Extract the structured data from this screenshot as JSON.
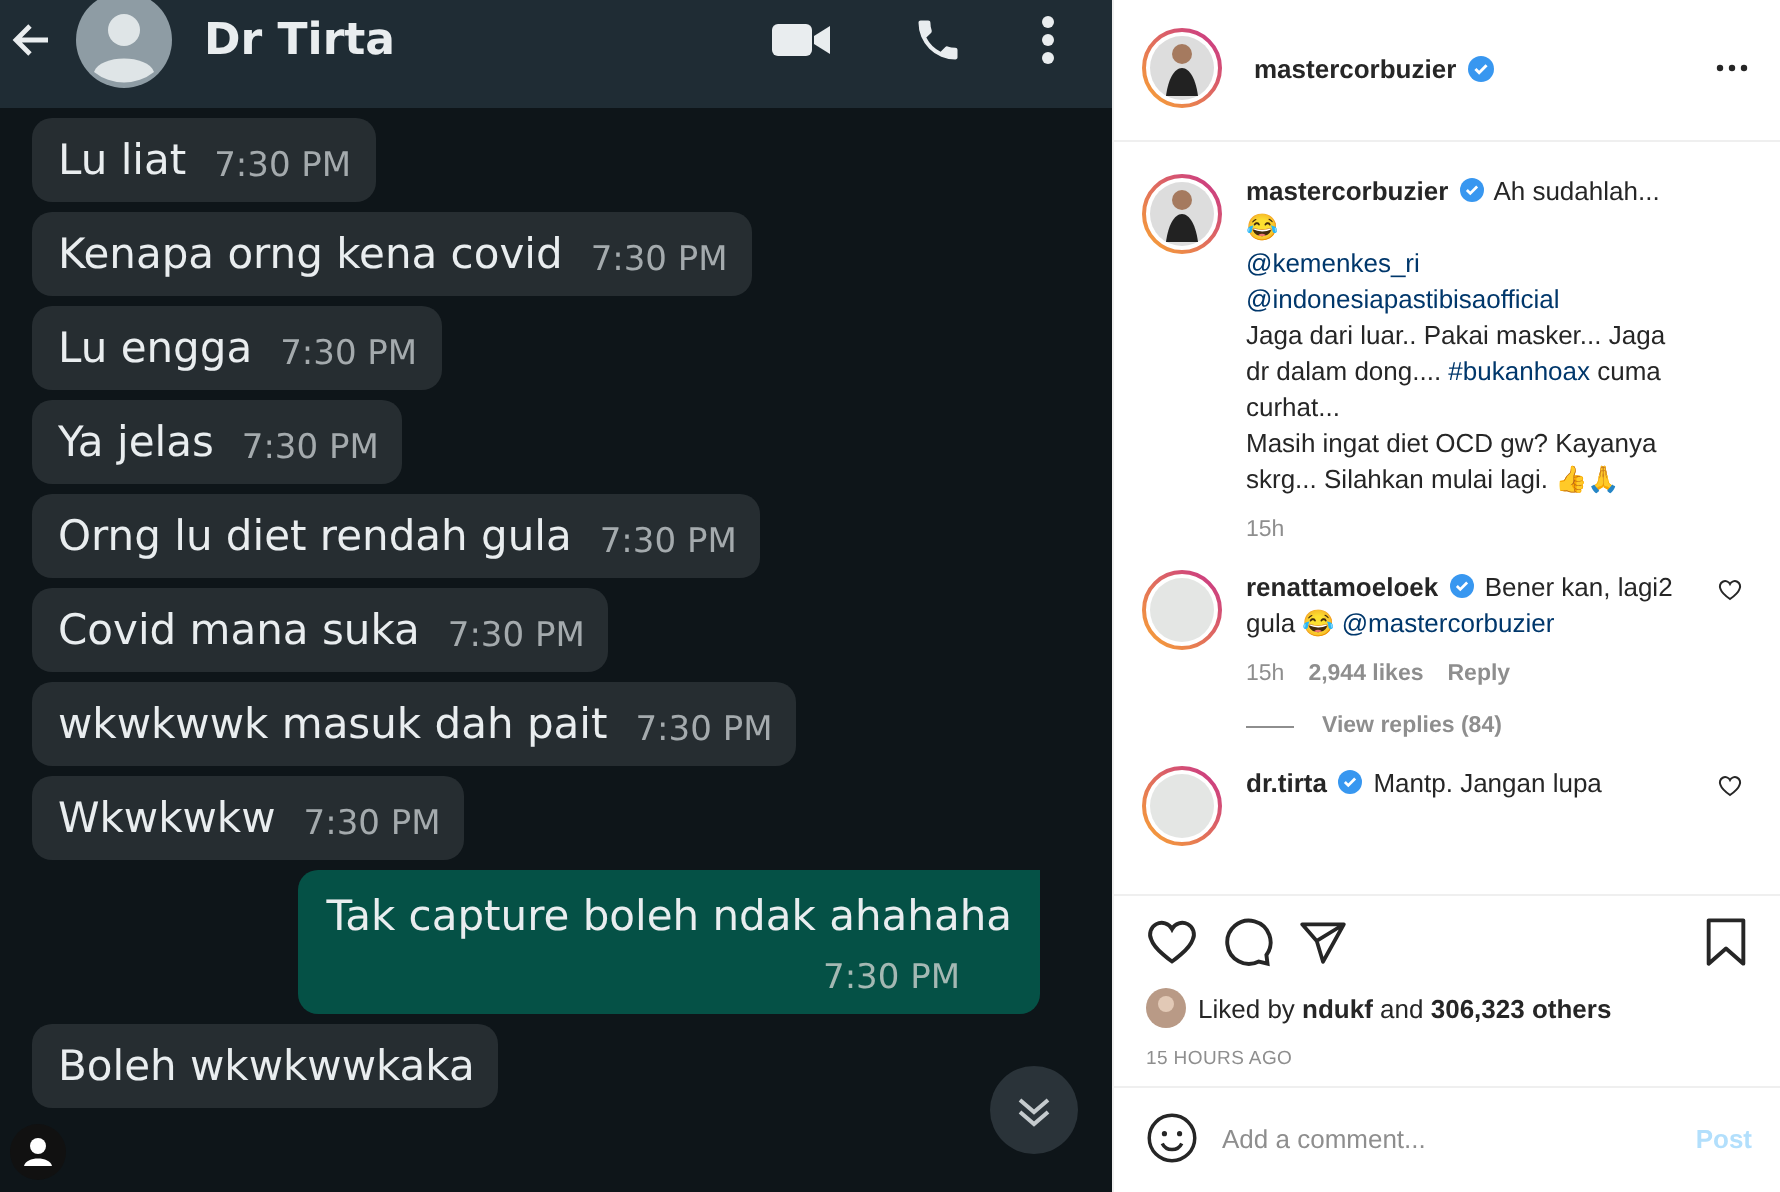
{
  "chat_screenshot": {
    "header": {
      "contact_name": "Dr Tirta"
    },
    "messages": [
      {
        "kind": "incoming",
        "text": "Lu liat",
        "time": "7:30 PM"
      },
      {
        "kind": "incoming",
        "text": "Kenapa orng kena covid",
        "time": "7:30 PM"
      },
      {
        "kind": "incoming",
        "text": "Lu engga",
        "time": "7:30 PM"
      },
      {
        "kind": "incoming",
        "text": "Ya jelas",
        "time": "7:30 PM"
      },
      {
        "kind": "incoming",
        "text": "Orng lu diet rendah gula",
        "time": "7:30 PM"
      },
      {
        "kind": "incoming",
        "text": "Covid mana suka",
        "time": "7:30 PM"
      },
      {
        "kind": "incoming",
        "text": "wkwkwwk masuk dah pait",
        "time": "7:30 PM"
      },
      {
        "kind": "incoming",
        "text": "Wkwkwkw",
        "time": "7:30 PM"
      },
      {
        "kind": "outgoing",
        "text": "Tak capture boleh ndak ahahaha",
        "time": "7:30 PM"
      },
      {
        "kind": "incoming",
        "text": "Boleh wkwkwwkaka"
      }
    ]
  },
  "post": {
    "author": {
      "username": "mastercorbuzier",
      "verified": true
    },
    "caption": {
      "username": "mastercorbuzier",
      "verified": true,
      "lines": [
        [
          {
            "kind": "text",
            "text": "Ah sudahlah... 😂"
          }
        ],
        [
          {
            "kind": "mention",
            "text": "@kemenkes_ri"
          }
        ],
        [
          {
            "kind": "mention",
            "text": "@indonesiapastibisaofficial"
          }
        ],
        [
          {
            "kind": "text",
            "text": "Jaga dari luar.. Pakai masker... Jaga dr dalam dong.... "
          },
          {
            "kind": "hashtag",
            "text": "#bukanhoax"
          },
          {
            "kind": "text",
            "text": " cuma curhat..."
          }
        ],
        [
          {
            "kind": "text",
            "text": "Masih ingat diet OCD gw? Kayanya skrg... Silahkan mulai lagi. 👍🙏"
          }
        ]
      ],
      "time": "15h"
    },
    "comments": [
      {
        "username": "renattamoeloek",
        "verified": true,
        "liked": false,
        "parts": [
          {
            "kind": "text",
            "text": "Bener kan, lagi2 gula 😂 "
          },
          {
            "kind": "mention",
            "text": "@mastercorbuzier"
          }
        ],
        "time": "15h",
        "likes": "2,944 likes",
        "reply": "Reply",
        "view_replies": "View replies (84)"
      },
      {
        "username": "dr.tirta",
        "verified": true,
        "liked": false,
        "parts": [
          {
            "kind": "text",
            "text": "Mantp. Jangan lupa"
          }
        ]
      }
    ],
    "liked": false,
    "saved": false,
    "liked_by": "Liked by **ndukf** and **306,323 others**",
    "timestamp": "15 HOURS AGO",
    "comment_field": {
      "placeholder": "Add a comment..."
    },
    "post_button": {
      "label": "Post",
      "disabled": true
    }
  }
}
